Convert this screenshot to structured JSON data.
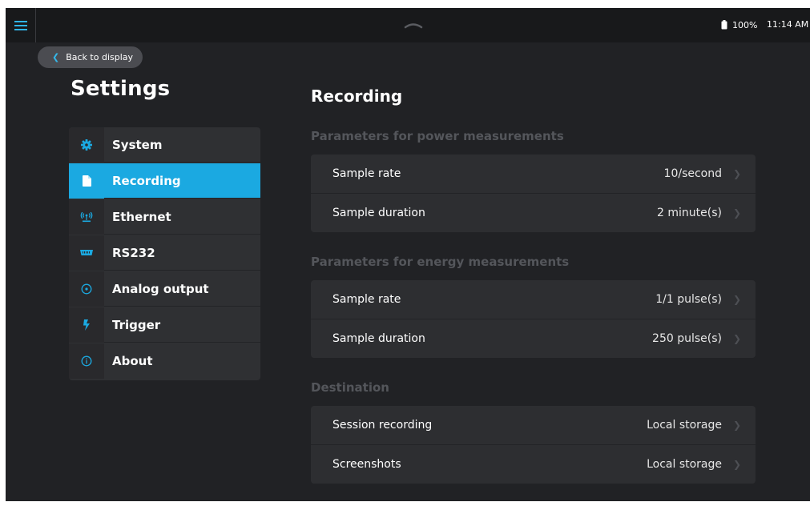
{
  "status_bar": {
    "battery": "100%",
    "time": "11:14 AM"
  },
  "back_button": "Back to display",
  "settings_title": "Settings",
  "menu": {
    "items": [
      {
        "label": "System",
        "icon": "gear-icon"
      },
      {
        "label": "Recording",
        "icon": "file-icon",
        "selected": true
      },
      {
        "label": "Ethernet",
        "icon": "antenna-icon"
      },
      {
        "label": "RS232",
        "icon": "serial-port-icon"
      },
      {
        "label": "Analog output",
        "icon": "circle-dot-icon"
      },
      {
        "label": "Trigger",
        "icon": "lightning-icon"
      },
      {
        "label": "About",
        "icon": "info-icon"
      }
    ]
  },
  "page": {
    "heading": "Recording",
    "sections": [
      {
        "title": "Parameters for power measurements",
        "rows": [
          {
            "label": "Sample rate",
            "value": "10/second"
          },
          {
            "label": "Sample duration",
            "value": "2 minute(s)"
          }
        ]
      },
      {
        "title": "Parameters for energy measurements",
        "rows": [
          {
            "label": "Sample rate",
            "value": "1/1 pulse(s)"
          },
          {
            "label": "Sample duration",
            "value": "250 pulse(s)"
          }
        ]
      },
      {
        "title": "Destination",
        "rows": [
          {
            "label": "Session recording",
            "value": "Local storage"
          },
          {
            "label": "Screenshots",
            "value": "Local storage"
          }
        ]
      }
    ]
  },
  "colors": {
    "accent": "#1ba9e1",
    "background": "#212225",
    "panel": "#2d2e31",
    "section_title": "#54565b"
  }
}
